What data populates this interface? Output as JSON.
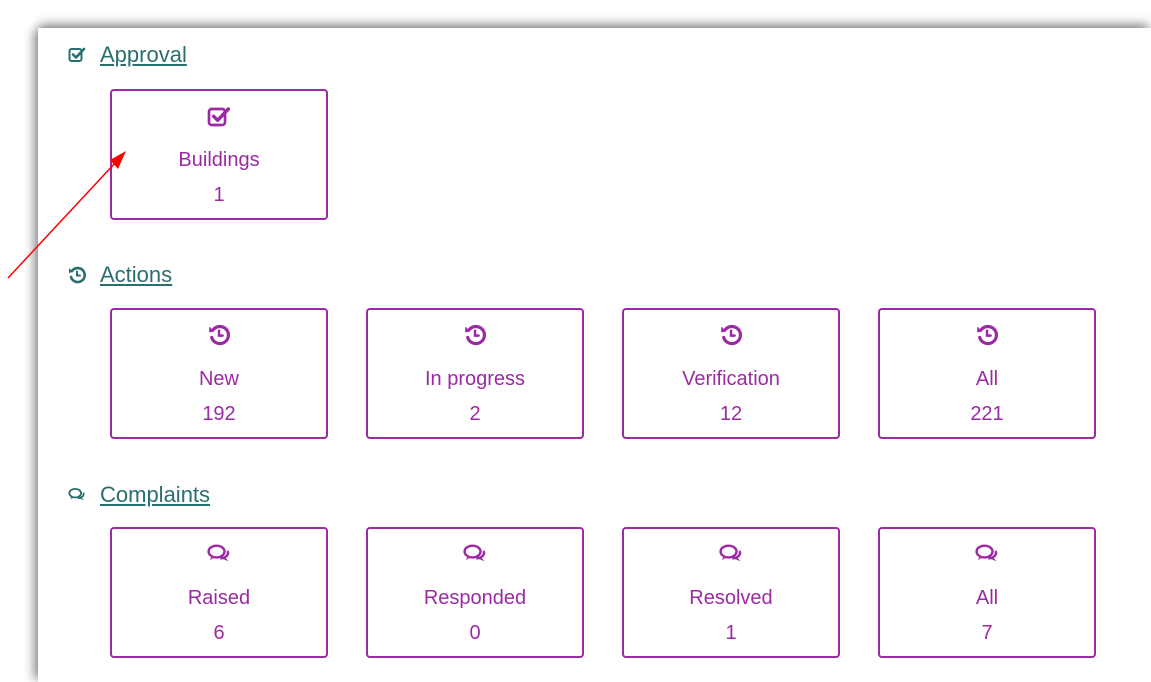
{
  "colors": {
    "heading": "#2a6f6f",
    "tile": "#9b2aa3",
    "annotation_arrow": "#ff0000"
  },
  "approval": {
    "title": "Approval",
    "icon": "check-square-icon",
    "tiles": [
      {
        "label": "Buildings",
        "count": "1",
        "icon": "check-square-icon"
      }
    ]
  },
  "actions": {
    "title": "Actions",
    "icon": "history-icon",
    "tiles": [
      {
        "label": "New",
        "count": "192",
        "icon": "history-icon"
      },
      {
        "label": "In progress",
        "count": "2",
        "icon": "history-icon"
      },
      {
        "label": "Verification",
        "count": "12",
        "icon": "history-icon"
      },
      {
        "label": "All",
        "count": "221",
        "icon": "history-icon"
      }
    ]
  },
  "complaints": {
    "title": "Complaints",
    "icon": "comments-icon",
    "tiles": [
      {
        "label": "Raised",
        "count": "6",
        "icon": "comments-icon"
      },
      {
        "label": "Responded",
        "count": "0",
        "icon": "comments-icon"
      },
      {
        "label": "Resolved",
        "count": "1",
        "icon": "comments-icon"
      },
      {
        "label": "All",
        "count": "7",
        "icon": "comments-icon"
      }
    ]
  }
}
